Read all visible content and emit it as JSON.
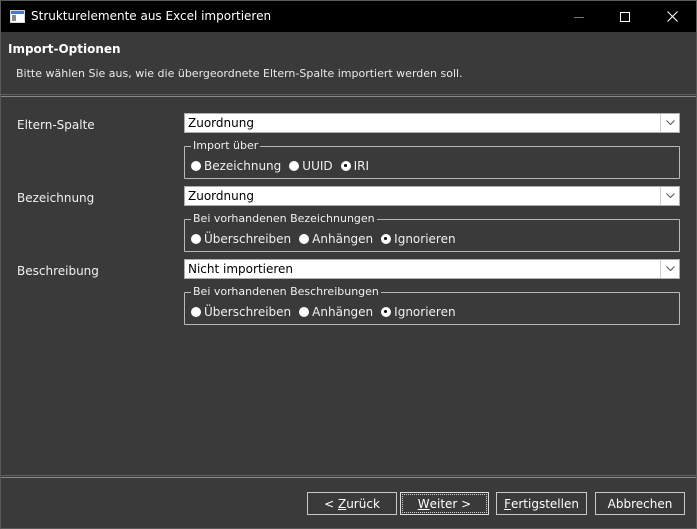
{
  "window": {
    "title": "Strukturelemente aus Excel importieren"
  },
  "header": {
    "title": "Import-Optionen",
    "description": "Bitte wählen Sie aus, wie die übergeordnete Eltern-Spalte importiert werden soll."
  },
  "rows": [
    {
      "label": "Eltern-Spalte",
      "selected": "Zuordnung",
      "group": {
        "legend": "Import über",
        "options": [
          {
            "label": "Bezeichnung",
            "checked": false
          },
          {
            "label": "UUID",
            "checked": false
          },
          {
            "label": "IRI",
            "checked": true
          }
        ]
      }
    },
    {
      "label": "Bezeichnung",
      "selected": "Zuordnung",
      "group": {
        "legend": "Bei vorhandenen Bezeichnungen",
        "options": [
          {
            "label": "Überschreiben",
            "checked": false
          },
          {
            "label": "Anhängen",
            "checked": false
          },
          {
            "label": "Ignorieren",
            "checked": true
          }
        ]
      }
    },
    {
      "label": "Beschreibung",
      "selected": "Nicht importieren",
      "group": {
        "legend": "Bei vorhandenen Beschreibungen",
        "options": [
          {
            "label": "Überschreiben",
            "checked": false
          },
          {
            "label": "Anhängen",
            "checked": false
          },
          {
            "label": "Ignorieren",
            "checked": true
          }
        ]
      }
    }
  ],
  "footer": {
    "back": {
      "pre": "< ",
      "mnemonic": "Z",
      "post": "urück"
    },
    "next": {
      "pre": "",
      "mnemonic": "W",
      "post": "eiter >"
    },
    "finish": {
      "pre": "",
      "mnemonic": "F",
      "post": "ertigstellen"
    },
    "cancel": {
      "label": "Abbrechen"
    }
  }
}
